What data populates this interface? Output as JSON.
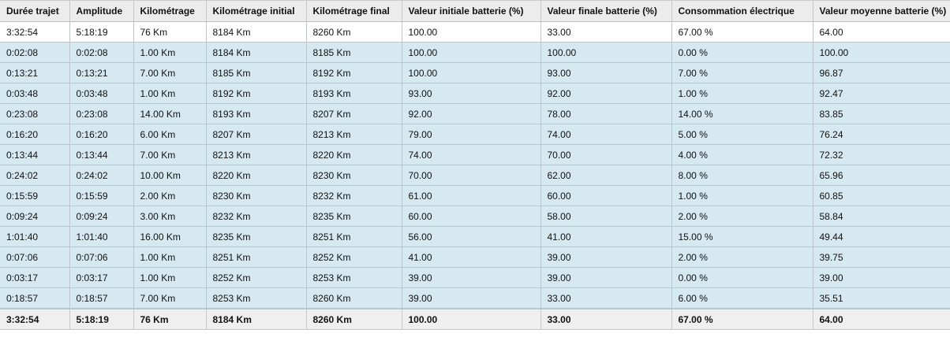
{
  "table": {
    "headers": [
      "Durée trajet",
      "Amplitude",
      "Kilométrage",
      "Kilométrage initial",
      "Kilométrage final",
      "Valeur initiale batterie (%)",
      "Valeur finale batterie (%)",
      "Consommation électrique",
      "Valeur moyenne batterie (%)"
    ],
    "rows": [
      [
        "3:32:54",
        "5:18:19",
        "76 Km",
        "8184 Km",
        "8260 Km",
        "100.00",
        "33.00",
        "67.00 %",
        "64.00"
      ],
      [
        "0:02:08",
        "0:02:08",
        "1.00 Km",
        "8184 Km",
        "8185 Km",
        "100.00",
        "100.00",
        "0.00 %",
        "100.00"
      ],
      [
        "0:13:21",
        "0:13:21",
        "7.00 Km",
        "8185 Km",
        "8192 Km",
        "100.00",
        "93.00",
        "7.00 %",
        "96.87"
      ],
      [
        "0:03:48",
        "0:03:48",
        "1.00 Km",
        "8192 Km",
        "8193 Km",
        "93.00",
        "92.00",
        "1.00 %",
        "92.47"
      ],
      [
        "0:23:08",
        "0:23:08",
        "14.00 Km",
        "8193 Km",
        "8207 Km",
        "92.00",
        "78.00",
        "14.00 %",
        "83.85"
      ],
      [
        "0:16:20",
        "0:16:20",
        "6.00 Km",
        "8207 Km",
        "8213 Km",
        "79.00",
        "74.00",
        "5.00 %",
        "76.24"
      ],
      [
        "0:13:44",
        "0:13:44",
        "7.00 Km",
        "8213 Km",
        "8220 Km",
        "74.00",
        "70.00",
        "4.00 %",
        "72.32"
      ],
      [
        "0:24:02",
        "0:24:02",
        "10.00 Km",
        "8220 Km",
        "8230 Km",
        "70.00",
        "62.00",
        "8.00 %",
        "65.96"
      ],
      [
        "0:15:59",
        "0:15:59",
        "2.00 Km",
        "8230 Km",
        "8232 Km",
        "61.00",
        "60.00",
        "1.00 %",
        "60.85"
      ],
      [
        "0:09:24",
        "0:09:24",
        "3.00 Km",
        "8232 Km",
        "8235 Km",
        "60.00",
        "58.00",
        "2.00 %",
        "58.84"
      ],
      [
        "1:01:40",
        "1:01:40",
        "16.00 Km",
        "8235 Km",
        "8251 Km",
        "56.00",
        "41.00",
        "15.00 %",
        "49.44"
      ],
      [
        "0:07:06",
        "0:07:06",
        "1.00 Km",
        "8251 Km",
        "8252 Km",
        "41.00",
        "39.00",
        "2.00 %",
        "39.75"
      ],
      [
        "0:03:17",
        "0:03:17",
        "1.00 Km",
        "8252 Km",
        "8253 Km",
        "39.00",
        "39.00",
        "0.00 %",
        "39.00"
      ],
      [
        "0:18:57",
        "0:18:57",
        "7.00 Km",
        "8253 Km",
        "8260 Km",
        "39.00",
        "33.00",
        "6.00 %",
        "35.51"
      ]
    ],
    "footer": [
      "3:32:54",
      "5:18:19",
      "76 Km",
      "8184 Km",
      "8260 Km",
      "100.00",
      "33.00",
      "67.00 %",
      "64.00"
    ]
  },
  "colors": {
    "header_bg": "#ececec",
    "row_bg": "#d6e8f0",
    "first_row_bg": "#ffffff",
    "footer_bg": "#efefef",
    "grid_line": "#b9c6cc"
  }
}
